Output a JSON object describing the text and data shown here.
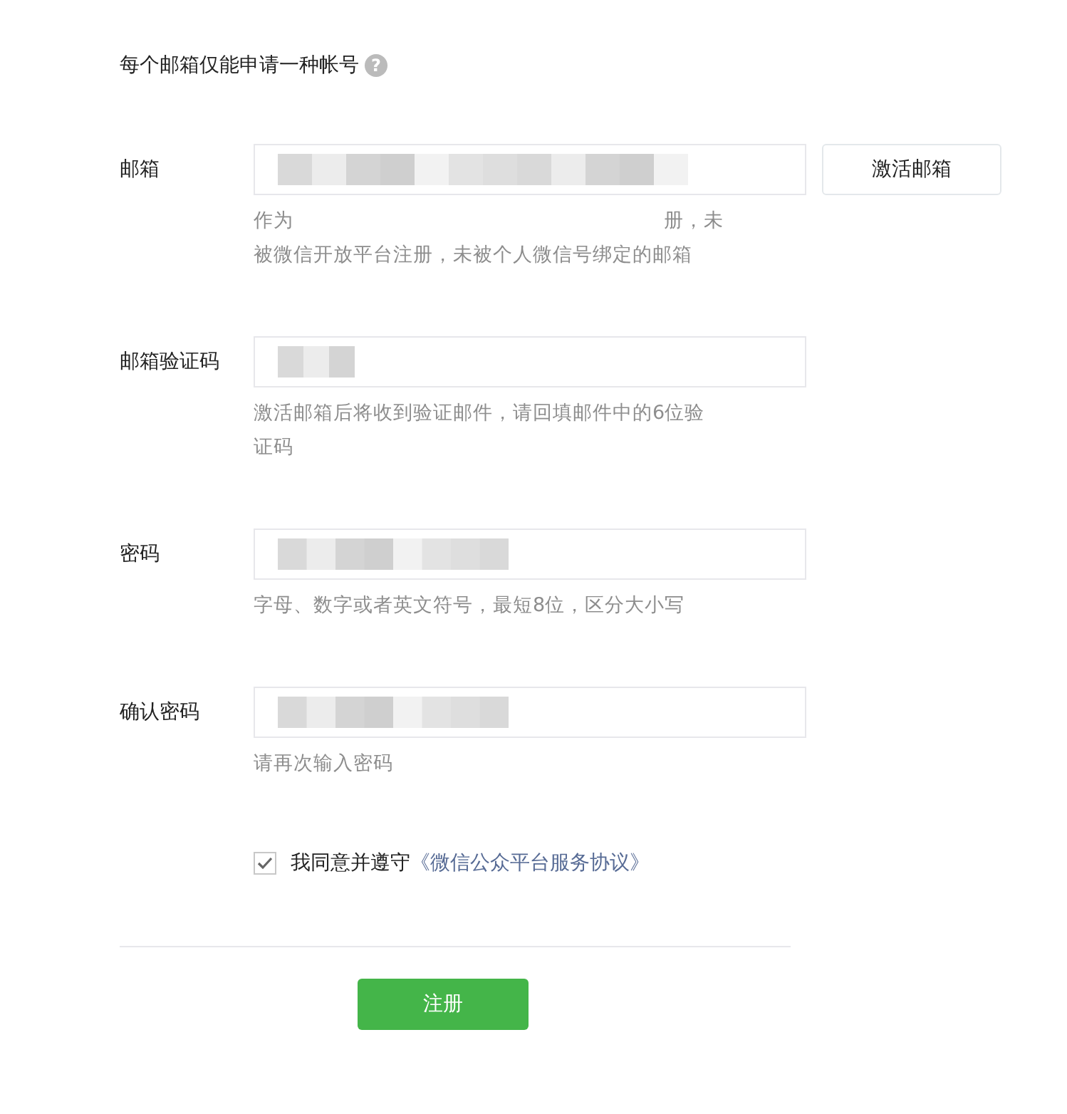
{
  "title": "每个邮箱仅能申请一种帐号",
  "help_icon": "?",
  "fields": [
    {
      "label": "邮箱",
      "hint_lines": [
        [
          "作为",
          "册，未"
        ],
        [
          "被微信开放平台注册，未被个人微信号绑定的邮箱"
        ]
      ],
      "button": "激活邮箱"
    },
    {
      "label": "邮箱验证码",
      "hint_lines": [
        [
          "激活邮箱后将收到验证邮件，请回填邮件中的6位验"
        ],
        [
          "证码"
        ]
      ]
    },
    {
      "label": "密码",
      "hint_lines": [
        [
          "字母、数字或者英文符号，最短8位，区分大小写"
        ]
      ]
    },
    {
      "label": "确认密码",
      "hint_lines": [
        [
          "请再次输入密码"
        ]
      ]
    }
  ],
  "agreement": {
    "checked": true,
    "text": "我同意并遵守",
    "link": "《微信公众平台服务协议》"
  },
  "submit": "注册"
}
